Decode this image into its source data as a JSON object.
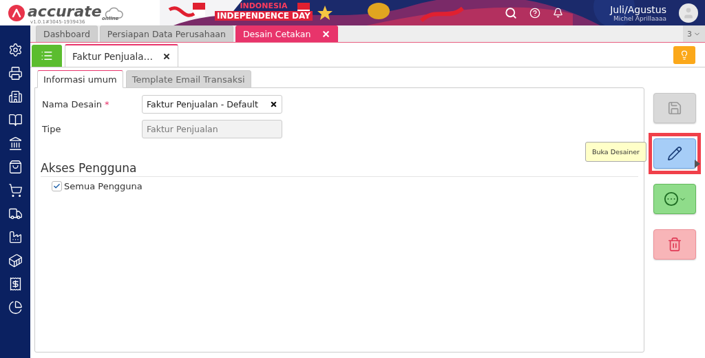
{
  "app": {
    "logo": "accurate",
    "logo_sub": "online",
    "version": "v1.0.1#3045-1939436"
  },
  "banner": {
    "lines": [
      "INDONESIA",
      "INDEPENDENCE DAY"
    ]
  },
  "user": {
    "period": "Juli/Agustus",
    "name": "Michel Aprillaaaa"
  },
  "sidebar": {
    "items": [
      {
        "kind": "settings"
      },
      {
        "kind": "printer"
      },
      {
        "kind": "building"
      },
      {
        "kind": "book"
      },
      {
        "kind": "bank"
      },
      {
        "kind": "bag"
      },
      {
        "kind": "cart"
      },
      {
        "kind": "trolley"
      },
      {
        "kind": "factory"
      },
      {
        "kind": "conveyor"
      },
      {
        "kind": "receipt"
      },
      {
        "kind": "report"
      }
    ]
  },
  "tabs": [
    {
      "label": "Dashboard",
      "selected": false,
      "closable": false
    },
    {
      "label": "Persiapan Data Perusahaan",
      "selected": false,
      "closable": false
    },
    {
      "label": "Desain Cetakan",
      "selected": true,
      "closable": true
    }
  ],
  "tab_count": "3",
  "module_tabs": [
    {
      "label": "Faktur Penjuala…",
      "selected": true
    }
  ],
  "form_tabs": [
    {
      "label": "Informasi umum",
      "selected": true
    },
    {
      "label": "Template Email Transaksi",
      "selected": false
    }
  ],
  "fields": [
    {
      "label": "Nama Desain",
      "required_mark": "*",
      "value": "Faktur Penjualan - Default",
      "disabled": false
    },
    {
      "label": "Tipe",
      "value": "Faktur Penjualan",
      "disabled": true
    }
  ],
  "section": {
    "title": "Akses Pengguna"
  },
  "checkbox": {
    "label": "Semua Pengguna",
    "checked": true
  },
  "actions": [
    {
      "kind": "save",
      "highlighted": false
    },
    {
      "kind": "edit",
      "highlighted": true
    },
    {
      "kind": "more",
      "highlighted": false
    },
    {
      "kind": "delete",
      "highlighted": false
    }
  ],
  "tooltip": {
    "text": "Buka Desainer"
  }
}
